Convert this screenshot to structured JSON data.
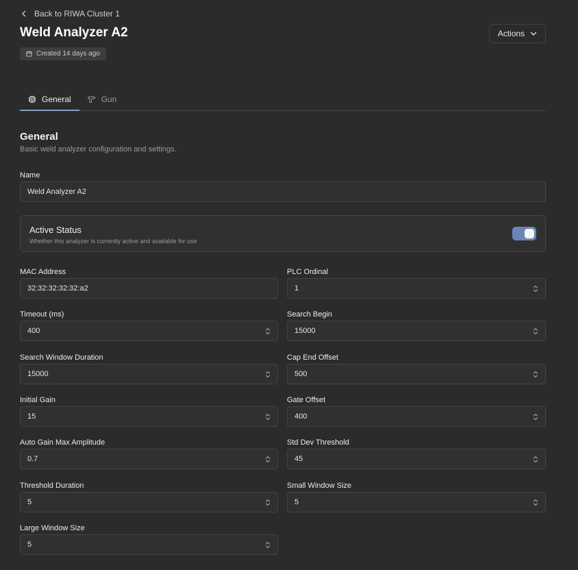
{
  "header": {
    "back_label": "Back to RIWA Cluster 1",
    "title": "Weld Analyzer A2",
    "created": "Created 14 days ago",
    "actions_label": "Actions"
  },
  "tabs": [
    {
      "label": "General",
      "icon": "chip-icon",
      "active": true
    },
    {
      "label": "Gun",
      "icon": "gun-icon",
      "active": false
    }
  ],
  "section": {
    "title": "General",
    "description": "Basic weld analyzer configuration and settings."
  },
  "name_field": {
    "label": "Name",
    "value": "Weld Analyzer A2"
  },
  "active_status": {
    "title": "Active Status",
    "description": "Whether this analyzer is currently active and available for use",
    "enabled": true
  },
  "fields": {
    "mac_address": {
      "label": "MAC Address",
      "value": "32:32:32:32:32:a2"
    },
    "plc_ordinal": {
      "label": "PLC Ordinal",
      "value": "1"
    },
    "timeout": {
      "label": "Timeout (ms)",
      "value": "400"
    },
    "search_begin": {
      "label": "Search Begin",
      "value": "15000"
    },
    "search_window_duration": {
      "label": "Search Window Duration",
      "value": "15000"
    },
    "cap_end_offset": {
      "label": "Cap End Offset",
      "value": "500"
    },
    "initial_gain": {
      "label": "Initial Gain",
      "value": "15"
    },
    "gate_offset": {
      "label": "Gate Offset",
      "value": "400"
    },
    "auto_gain_max_amplitude": {
      "label": "Auto Gain Max Amplitude",
      "value": "0.7"
    },
    "std_dev_threshold": {
      "label": "Std Dev Threshold",
      "value": "45"
    },
    "threshold_duration": {
      "label": "Threshold Duration",
      "value": "5"
    },
    "small_window_size": {
      "label": "Small Window Size",
      "value": "5"
    },
    "large_window_size": {
      "label": "Large Window Size",
      "value": "5"
    }
  },
  "colors": {
    "background": "#2b2b2b",
    "accent": "#6a86b5",
    "field_background": "#303030"
  }
}
